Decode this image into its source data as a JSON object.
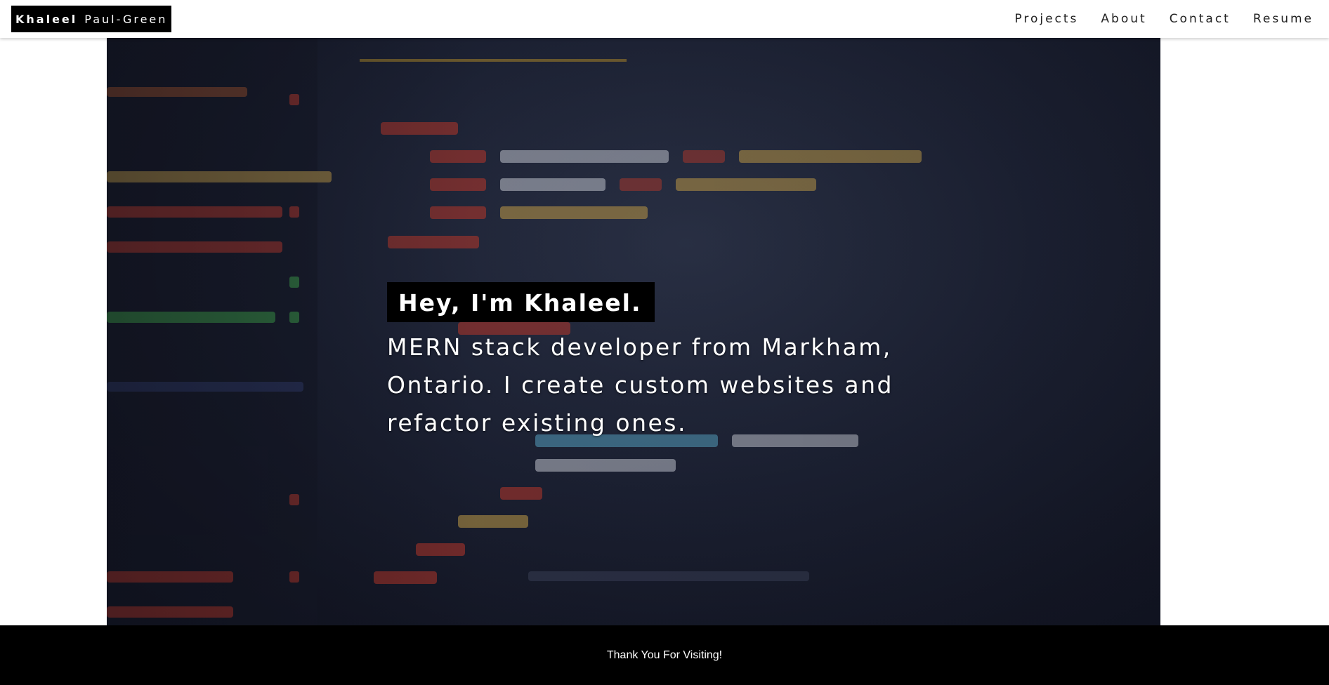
{
  "navbar": {
    "brand_first": "Khaleel",
    "brand_last": "Paul-Green",
    "links": [
      {
        "label": "Projects"
      },
      {
        "label": "About"
      },
      {
        "label": "Contact"
      },
      {
        "label": "Resume"
      }
    ]
  },
  "hero": {
    "headline": "Hey, I'm Khaleel.",
    "tagline": "MERN stack developer from Markham, Ontario. I create custom websites and refactor existing ones."
  },
  "footer": {
    "text": "Thank You For Visiting!"
  },
  "colors": {
    "nav_bg": "#ffffff",
    "brand_bg": "#000000",
    "footer_bg": "#000000",
    "hero_bg": "#1c2133"
  }
}
